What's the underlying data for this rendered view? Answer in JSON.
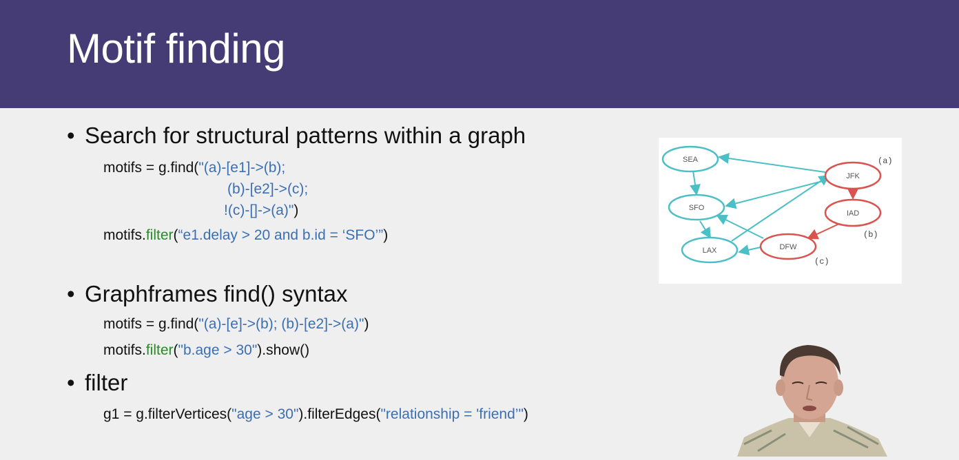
{
  "slide": {
    "title": "Motif finding"
  },
  "bullets": [
    {
      "text": "Search for structural patterns within a graph"
    },
    {
      "text": "Graphframes find() syntax"
    },
    {
      "text": "filter"
    }
  ],
  "code1": {
    "line1_pre": "motifs = g.find(",
    "line1_str": "\"(a)-[e1]->(b);",
    "line2_str": "(b)-[e2]->(c);",
    "line3_str": "!(c)-[]->(a)\"",
    "line3_post": ")",
    "line4_pre": "motifs.",
    "line4_fn": "filter",
    "line4_open": "(",
    "line4_str": "“e1.delay > 20 and b.id = ‘SFO’”",
    "line4_post": ")"
  },
  "code2": {
    "line1_pre": "motifs = g.find(",
    "line1_str": "\"(a)-[e]->(b); (b)-[e2]->(a)\"",
    "line1_post": ")",
    "line2_pre": "motifs.",
    "line2_fn": "filter",
    "line2_open": "(",
    "line2_str": "\"b.age > 30\"",
    "line2_post": ").show()"
  },
  "code3": {
    "pre": "g1 = g.filterVertices(",
    "str1": "\"age > 30\"",
    "mid": ").filterEdges(",
    "str2": "\"relationship = 'friend’\"",
    "post": ")"
  },
  "graph": {
    "nodes": [
      {
        "id": "SEA",
        "label": "SEA",
        "color": "#4bbfc6"
      },
      {
        "id": "SFO",
        "label": "SFO",
        "color": "#4bbfc6"
      },
      {
        "id": "LAX",
        "label": "LAX",
        "color": "#4bbfc6"
      },
      {
        "id": "JFK",
        "label": "JFK",
        "color": "#d9534f"
      },
      {
        "id": "IAD",
        "label": "IAD",
        "color": "#d9534f"
      },
      {
        "id": "DFW",
        "label": "DFW",
        "color": "#d9534f"
      }
    ],
    "tags": {
      "a": "(a)",
      "b": "(b)",
      "c": "(c)"
    }
  },
  "colors": {
    "header": "#463c75",
    "string": "#3a6fb4",
    "function": "#2a8a2a",
    "cyan_node": "#4bbfc6",
    "red_node": "#d9534f"
  }
}
